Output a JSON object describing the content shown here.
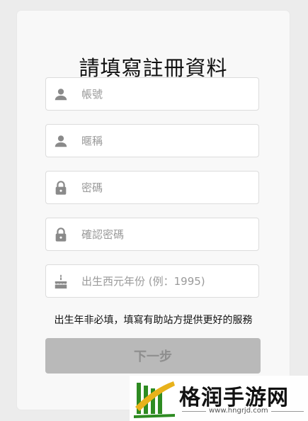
{
  "form": {
    "title": "請填寫註冊資料",
    "fields": [
      {
        "icon": "person-icon",
        "placeholder": "帳號",
        "value": ""
      },
      {
        "icon": "person-icon",
        "placeholder": "暱稱",
        "value": ""
      },
      {
        "icon": "lock-icon",
        "placeholder": "密碼",
        "value": ""
      },
      {
        "icon": "lock-icon",
        "placeholder": "確認密碼",
        "value": ""
      },
      {
        "icon": "birthday-cake-icon",
        "placeholder": "出生西元年份 (例：1995)",
        "value": ""
      }
    ],
    "note": "出生年非必填，填寫有助站方提供更好的服務",
    "next_label": "下一步"
  },
  "watermark": {
    "site_name": "格润手游网",
    "url": "www.hngrjd.com"
  },
  "colors": {
    "background": "#ececec",
    "card": "#f8f8f8",
    "button_disabled": "#b9b9b9",
    "icon": "#8a8a8a",
    "watermark_green": "#2e8b22"
  }
}
